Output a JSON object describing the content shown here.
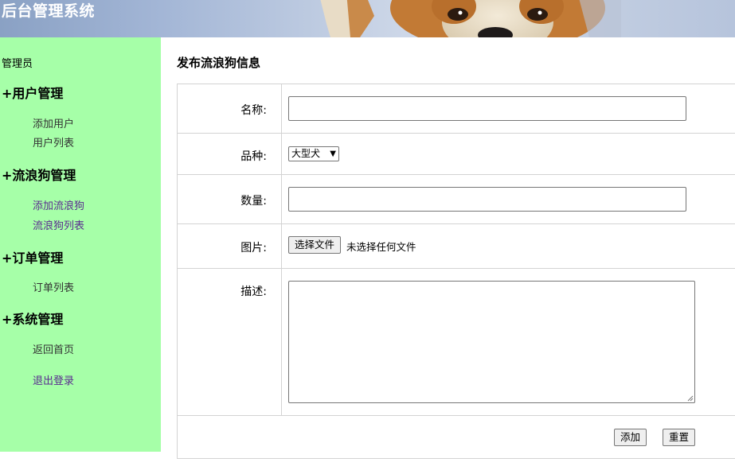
{
  "header": {
    "title": "后台管理系统"
  },
  "sidebar": {
    "role": "管理员",
    "groups": [
      {
        "title": "+用户管理",
        "items": [
          "添加用户",
          "用户列表"
        ]
      },
      {
        "title": "+流浪狗管理",
        "items": [
          "添加流浪狗",
          "流浪狗列表"
        ]
      },
      {
        "title": "+订单管理",
        "items": [
          "订单列表"
        ]
      },
      {
        "title": "+系统管理",
        "items": [
          "返回首页",
          "退出登录"
        ]
      }
    ]
  },
  "main": {
    "title": "发布流浪狗信息",
    "form": {
      "name_label": "名称:",
      "breed_label": "品种:",
      "breed_selected": "大型犬",
      "quantity_label": "数量:",
      "image_label": "图片:",
      "file_button": "选择文件",
      "file_status": "未选择任何文件",
      "desc_label": "描述:",
      "name_value": "",
      "quantity_value": "",
      "desc_value": "",
      "add_button": "添加",
      "reset_button": "重置"
    }
  },
  "colors": {
    "sidebar_bg": "#a6ffa8",
    "border": "#d3d3d3",
    "visited_link": "#5a2d8f"
  }
}
